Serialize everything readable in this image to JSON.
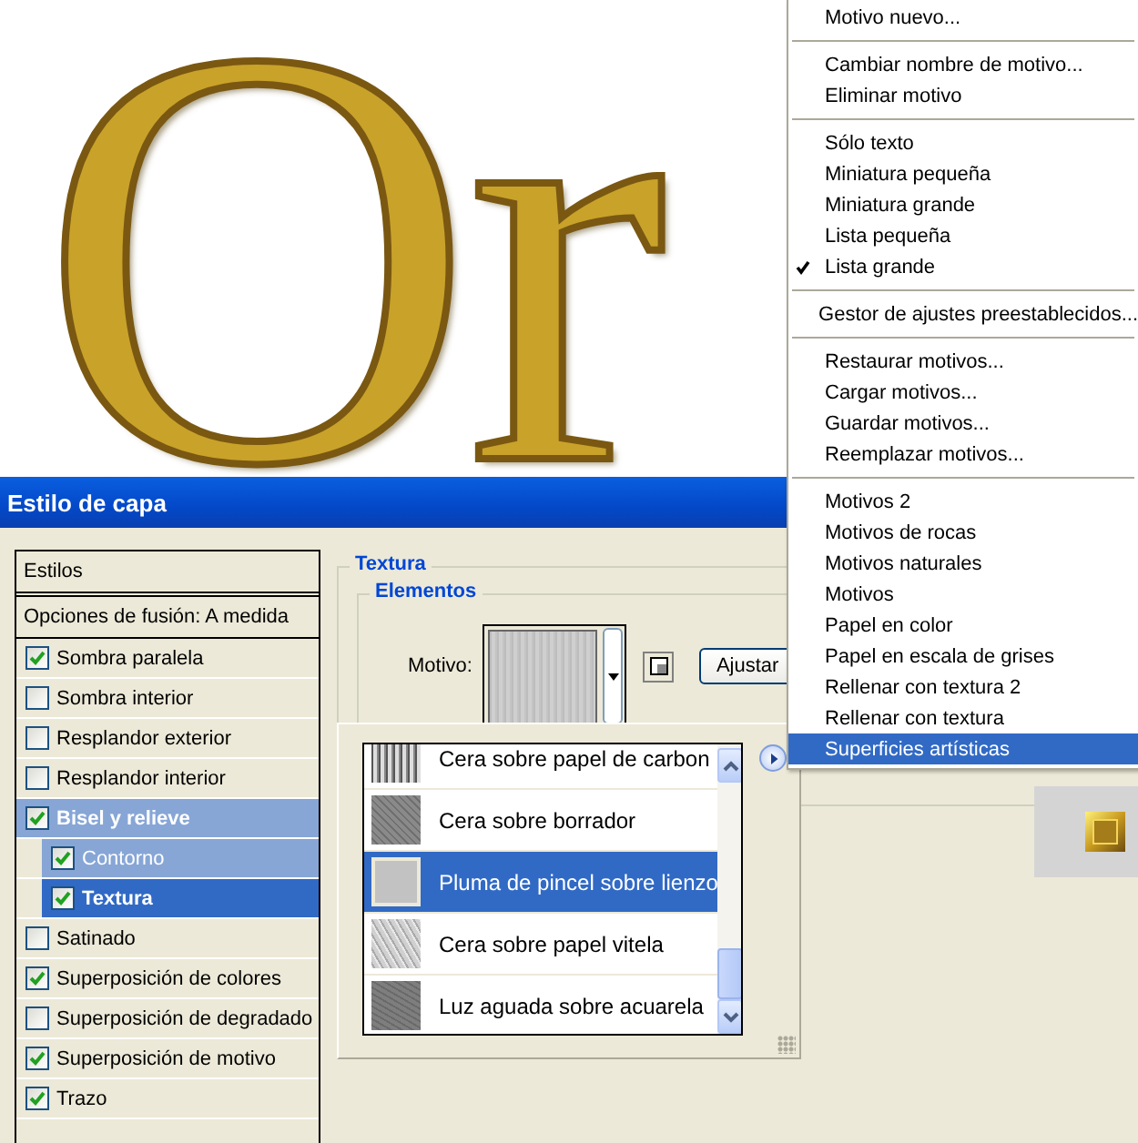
{
  "canvas": {
    "text": "Or"
  },
  "dialog": {
    "title": "Estilo de capa",
    "styles_panel": {
      "header": "Estilos",
      "blend_options": "Opciones de fusión: A medida",
      "effects": [
        {
          "label": "Sombra paralela",
          "checked": true,
          "selected": false
        },
        {
          "label": "Sombra interior",
          "checked": false,
          "selected": false
        },
        {
          "label": "Resplandor exterior",
          "checked": false,
          "selected": false
        },
        {
          "label": "Resplandor interior",
          "checked": false,
          "selected": false
        },
        {
          "label": "Bisel y relieve",
          "checked": true,
          "selected": false,
          "expanded": true,
          "children": [
            {
              "label": "Contorno",
              "checked": true,
              "selected": false
            },
            {
              "label": "Textura",
              "checked": true,
              "selected": true
            }
          ]
        },
        {
          "label": "Satinado",
          "checked": false,
          "selected": false
        },
        {
          "label": "Superposición de colores",
          "checked": true,
          "selected": false
        },
        {
          "label": "Superposición de degradado",
          "checked": false,
          "selected": false
        },
        {
          "label": "Superposición de motivo",
          "checked": true,
          "selected": false
        },
        {
          "label": "Trazo",
          "checked": true,
          "selected": false
        }
      ]
    },
    "texture": {
      "title": "Textura",
      "group": "Elementos",
      "pattern_label": "Motivo:",
      "adjust_button": "Ajustar"
    }
  },
  "pattern_picker": {
    "items": [
      {
        "label": "Cera sobre papel de carbon",
        "selected": false
      },
      {
        "label": "Cera sobre borrador",
        "selected": false
      },
      {
        "label": "Pluma de pincel sobre lienzo",
        "selected": true
      },
      {
        "label": "Cera sobre papel vitela",
        "selected": false
      },
      {
        "label": "Luz aguada sobre acuarela",
        "selected": false
      }
    ]
  },
  "menu": {
    "items": [
      {
        "kind": "item",
        "label": "Motivo nuevo...",
        "checked": false,
        "selected": false
      },
      {
        "kind": "separator"
      },
      {
        "kind": "item",
        "label": "Cambiar nombre de motivo...",
        "checked": false,
        "selected": false
      },
      {
        "kind": "item",
        "label": "Eliminar motivo",
        "checked": false,
        "selected": false
      },
      {
        "kind": "separator"
      },
      {
        "kind": "item",
        "label": "Sólo texto",
        "checked": false,
        "selected": false
      },
      {
        "kind": "item",
        "label": "Miniatura pequeña",
        "checked": false,
        "selected": false
      },
      {
        "kind": "item",
        "label": "Miniatura grande",
        "checked": false,
        "selected": false
      },
      {
        "kind": "item",
        "label": "Lista pequeña",
        "checked": false,
        "selected": false
      },
      {
        "kind": "item",
        "label": "Lista grande",
        "checked": true,
        "selected": false
      },
      {
        "kind": "separator"
      },
      {
        "kind": "item",
        "label": "Gestor de ajustes preestablecidos...",
        "checked": false,
        "selected": false
      },
      {
        "kind": "separator"
      },
      {
        "kind": "item",
        "label": "Restaurar motivos...",
        "checked": false,
        "selected": false
      },
      {
        "kind": "item",
        "label": "Cargar motivos...",
        "checked": false,
        "selected": false
      },
      {
        "kind": "item",
        "label": "Guardar motivos...",
        "checked": false,
        "selected": false
      },
      {
        "kind": "item",
        "label": "Reemplazar motivos...",
        "checked": false,
        "selected": false
      },
      {
        "kind": "separator"
      },
      {
        "kind": "item",
        "label": "Motivos 2",
        "checked": false,
        "selected": false
      },
      {
        "kind": "item",
        "label": "Motivos de rocas",
        "checked": false,
        "selected": false
      },
      {
        "kind": "item",
        "label": "Motivos naturales",
        "checked": false,
        "selected": false
      },
      {
        "kind": "item",
        "label": "Motivos",
        "checked": false,
        "selected": false
      },
      {
        "kind": "item",
        "label": "Papel en color",
        "checked": false,
        "selected": false
      },
      {
        "kind": "item",
        "label": "Papel en escala de grises",
        "checked": false,
        "selected": false
      },
      {
        "kind": "item",
        "label": "Rellenar con textura 2",
        "checked": false,
        "selected": false
      },
      {
        "kind": "item",
        "label": "Rellenar con textura",
        "checked": false,
        "selected": false
      },
      {
        "kind": "item",
        "label": "Superficies artísticas",
        "checked": false,
        "selected": true
      }
    ]
  }
}
